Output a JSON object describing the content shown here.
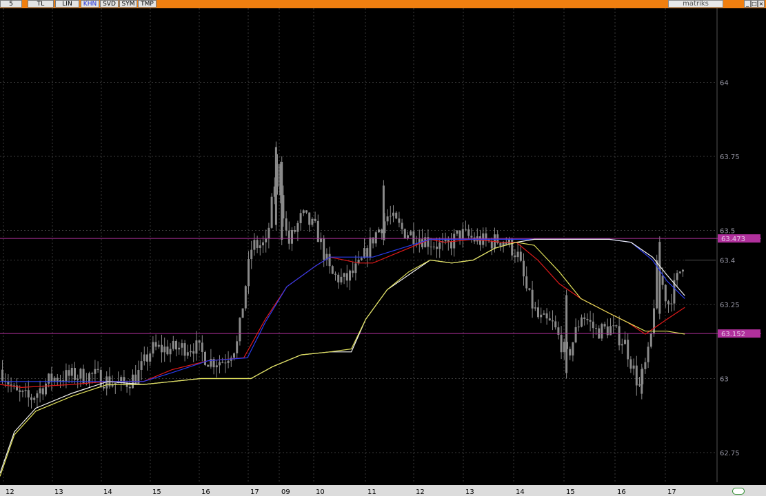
{
  "toolbar": {
    "buttons": [
      {
        "label": "5"
      },
      {
        "label": "TL"
      },
      {
        "label": "LIN"
      },
      {
        "label": "KHN",
        "active": true
      },
      {
        "label": "SVD"
      },
      {
        "label": "SYM"
      },
      {
        "label": "TMP"
      }
    ],
    "brand": "matriks",
    "window_buttons": [
      "_",
      "□",
      "×"
    ]
  },
  "colors": {
    "background": "#000000",
    "toolbar": "#f07f10",
    "grid": "#3a3a3a",
    "candle": "#8a8a8a",
    "level_line": "#b0309c",
    "series_red": "#e01a1a",
    "series_blue": "#2a3cf0",
    "series_white": "#f2f2f2",
    "series_yellow": "#e0e05a"
  },
  "chart_data": {
    "type": "line",
    "ylim": [
      62.65,
      64.25
    ],
    "y_ticks": [
      {
        "v": 64,
        "label": "64"
      },
      {
        "v": 63.75,
        "label": "63.75"
      },
      {
        "v": 63.5,
        "label": "63.5"
      },
      {
        "v": 63.4,
        "label": "63.4"
      },
      {
        "v": 63.25,
        "label": "63.25"
      },
      {
        "v": 63,
        "label": "63"
      },
      {
        "v": 62.75,
        "label": "62.75"
      }
    ],
    "x_ticks": [
      "12",
      "13",
      "14",
      "15",
      "16",
      "17",
      "09",
      "10",
      "11",
      "12",
      "13",
      "14",
      "15",
      "16",
      "17"
    ],
    "levels": [
      {
        "value": 63.473,
        "label": "63.473"
      },
      {
        "value": 63.152,
        "label": "63.152"
      }
    ],
    "price_marker": {
      "value": 63.4
    },
    "candle_anchors": [
      {
        "x": 0,
        "y": 63.03
      },
      {
        "x": 0.02,
        "y": 62.95
      },
      {
        "x": 0.04,
        "y": 62.93
      },
      {
        "x": 0.07,
        "y": 63.0
      },
      {
        "x": 0.1,
        "y": 63.01
      },
      {
        "x": 0.13,
        "y": 63.01
      },
      {
        "x": 0.15,
        "y": 62.99
      },
      {
        "x": 0.17,
        "y": 62.98
      },
      {
        "x": 0.19,
        "y": 63.01
      },
      {
        "x": 0.21,
        "y": 63.1
      },
      {
        "x": 0.24,
        "y": 63.1
      },
      {
        "x": 0.27,
        "y": 63.11
      },
      {
        "x": 0.29,
        "y": 63.06
      },
      {
        "x": 0.31,
        "y": 63.06
      },
      {
        "x": 0.33,
        "y": 63.12
      },
      {
        "x": 0.34,
        "y": 63.3
      },
      {
        "x": 0.35,
        "y": 63.45
      },
      {
        "x": 0.37,
        "y": 63.45
      },
      {
        "x": 0.385,
        "y": 63.72
      },
      {
        "x": 0.4,
        "y": 63.45
      },
      {
        "x": 0.42,
        "y": 63.55
      },
      {
        "x": 0.44,
        "y": 63.5
      },
      {
        "x": 0.46,
        "y": 63.35
      },
      {
        "x": 0.48,
        "y": 63.33
      },
      {
        "x": 0.5,
        "y": 63.38
      },
      {
        "x": 0.52,
        "y": 63.48
      },
      {
        "x": 0.54,
        "y": 63.55
      },
      {
        "x": 0.56,
        "y": 63.5
      },
      {
        "x": 0.58,
        "y": 63.48
      },
      {
        "x": 0.6,
        "y": 63.46
      },
      {
        "x": 0.62,
        "y": 63.44
      },
      {
        "x": 0.64,
        "y": 63.49
      },
      {
        "x": 0.66,
        "y": 63.47
      },
      {
        "x": 0.68,
        "y": 63.46
      },
      {
        "x": 0.7,
        "y": 63.47
      },
      {
        "x": 0.72,
        "y": 63.42
      },
      {
        "x": 0.735,
        "y": 63.28
      },
      {
        "x": 0.75,
        "y": 63.2
      },
      {
        "x": 0.77,
        "y": 63.18
      },
      {
        "x": 0.79,
        "y": 63.07
      },
      {
        "x": 0.81,
        "y": 63.22
      },
      {
        "x": 0.83,
        "y": 63.16
      },
      {
        "x": 0.85,
        "y": 63.17
      },
      {
        "x": 0.87,
        "y": 63.12
      },
      {
        "x": 0.89,
        "y": 62.97
      },
      {
        "x": 0.905,
        "y": 63.1
      },
      {
        "x": 0.915,
        "y": 63.38
      },
      {
        "x": 0.93,
        "y": 63.25
      },
      {
        "x": 0.945,
        "y": 63.35
      },
      {
        "x": 0.955,
        "y": 63.42
      }
    ],
    "spikes": [
      {
        "x": 0.385,
        "hi": 63.8,
        "lo": 63.5
      },
      {
        "x": 0.393,
        "hi": 63.75,
        "lo": 63.45
      },
      {
        "x": 0.535,
        "hi": 63.67,
        "lo": 63.45
      },
      {
        "x": 0.79,
        "hi": 63.3,
        "lo": 63.0
      },
      {
        "x": 0.895,
        "hi": 63.05,
        "lo": 62.93
      },
      {
        "x": 0.92,
        "hi": 63.48,
        "lo": 63.2
      }
    ],
    "series": [
      {
        "color": "red",
        "points": [
          {
            "x": 0,
            "y": 62.98
          },
          {
            "x": 0.03,
            "y": 62.97
          },
          {
            "x": 0.1,
            "y": 62.98
          },
          {
            "x": 0.15,
            "y": 62.99
          },
          {
            "x": 0.2,
            "y": 62.99
          },
          {
            "x": 0.24,
            "y": 63.03
          },
          {
            "x": 0.29,
            "y": 63.06
          },
          {
            "x": 0.34,
            "y": 63.07
          },
          {
            "x": 0.37,
            "y": 63.2
          },
          {
            "x": 0.4,
            "y": 63.31
          },
          {
            "x": 0.44,
            "y": 63.38
          },
          {
            "x": 0.46,
            "y": 63.41
          },
          {
            "x": 0.5,
            "y": 63.39
          },
          {
            "x": 0.52,
            "y": 63.39
          },
          {
            "x": 0.56,
            "y": 63.43
          },
          {
            "x": 0.6,
            "y": 63.47
          },
          {
            "x": 0.62,
            "y": 63.46
          },
          {
            "x": 0.66,
            "y": 63.47
          },
          {
            "x": 0.7,
            "y": 63.46
          },
          {
            "x": 0.72,
            "y": 63.46
          },
          {
            "x": 0.75,
            "y": 63.4
          },
          {
            "x": 0.78,
            "y": 63.32
          },
          {
            "x": 0.81,
            "y": 63.27
          },
          {
            "x": 0.85,
            "y": 63.22
          },
          {
            "x": 0.875,
            "y": 63.19
          },
          {
            "x": 0.9,
            "y": 63.15
          },
          {
            "x": 0.93,
            "y": 63.2
          },
          {
            "x": 0.955,
            "y": 63.24
          }
        ]
      },
      {
        "color": "blue",
        "points": [
          {
            "x": 0,
            "y": 62.99
          },
          {
            "x": 0.03,
            "y": 62.99
          },
          {
            "x": 0.1,
            "y": 62.99
          },
          {
            "x": 0.15,
            "y": 62.99
          },
          {
            "x": 0.2,
            "y": 62.99
          },
          {
            "x": 0.24,
            "y": 63.02
          },
          {
            "x": 0.29,
            "y": 63.06
          },
          {
            "x": 0.345,
            "y": 63.07
          },
          {
            "x": 0.37,
            "y": 63.19
          },
          {
            "x": 0.4,
            "y": 63.31
          },
          {
            "x": 0.44,
            "y": 63.38
          },
          {
            "x": 0.46,
            "y": 63.41
          },
          {
            "x": 0.5,
            "y": 63.41
          },
          {
            "x": 0.52,
            "y": 63.41
          },
          {
            "x": 0.56,
            "y": 63.44
          },
          {
            "x": 0.6,
            "y": 63.47
          },
          {
            "x": 0.66,
            "y": 63.47
          },
          {
            "x": 0.72,
            "y": 63.47
          },
          {
            "x": 0.78,
            "y": 63.47
          },
          {
            "x": 0.85,
            "y": 63.47
          },
          {
            "x": 0.88,
            "y": 63.46
          },
          {
            "x": 0.91,
            "y": 63.4
          },
          {
            "x": 0.93,
            "y": 63.33
          },
          {
            "x": 0.955,
            "y": 63.27
          }
        ]
      },
      {
        "color": "white",
        "points": [
          {
            "x": 0,
            "y": 62.68
          },
          {
            "x": 0.02,
            "y": 62.82
          },
          {
            "x": 0.05,
            "y": 62.9
          },
          {
            "x": 0.1,
            "y": 62.95
          },
          {
            "x": 0.15,
            "y": 62.99
          },
          {
            "x": 0.2,
            "y": 62.98
          },
          {
            "x": 0.24,
            "y": 62.99
          },
          {
            "x": 0.28,
            "y": 63.0
          },
          {
            "x": 0.33,
            "y": 63.0
          },
          {
            "x": 0.35,
            "y": 63.0
          },
          {
            "x": 0.38,
            "y": 63.04
          },
          {
            "x": 0.42,
            "y": 63.08
          },
          {
            "x": 0.46,
            "y": 63.09
          },
          {
            "x": 0.49,
            "y": 63.09
          },
          {
            "x": 0.51,
            "y": 63.2
          },
          {
            "x": 0.54,
            "y": 63.3
          },
          {
            "x": 0.57,
            "y": 63.35
          },
          {
            "x": 0.6,
            "y": 63.4
          },
          {
            "x": 0.63,
            "y": 63.39
          },
          {
            "x": 0.66,
            "y": 63.4
          },
          {
            "x": 0.69,
            "y": 63.44
          },
          {
            "x": 0.72,
            "y": 63.46
          },
          {
            "x": 0.745,
            "y": 63.47
          },
          {
            "x": 0.78,
            "y": 63.47
          },
          {
            "x": 0.85,
            "y": 63.47
          },
          {
            "x": 0.88,
            "y": 63.46
          },
          {
            "x": 0.91,
            "y": 63.41
          },
          {
            "x": 0.93,
            "y": 63.35
          },
          {
            "x": 0.955,
            "y": 63.28
          }
        ]
      },
      {
        "color": "yellow",
        "points": [
          {
            "x": 0,
            "y": 62.67
          },
          {
            "x": 0.02,
            "y": 62.81
          },
          {
            "x": 0.05,
            "y": 62.89
          },
          {
            "x": 0.1,
            "y": 62.94
          },
          {
            "x": 0.15,
            "y": 62.98
          },
          {
            "x": 0.2,
            "y": 62.98
          },
          {
            "x": 0.24,
            "y": 62.99
          },
          {
            "x": 0.28,
            "y": 63.0
          },
          {
            "x": 0.35,
            "y": 63.0
          },
          {
            "x": 0.38,
            "y": 63.04
          },
          {
            "x": 0.42,
            "y": 63.08
          },
          {
            "x": 0.46,
            "y": 63.09
          },
          {
            "x": 0.49,
            "y": 63.1
          },
          {
            "x": 0.51,
            "y": 63.2
          },
          {
            "x": 0.54,
            "y": 63.3
          },
          {
            "x": 0.57,
            "y": 63.36
          },
          {
            "x": 0.6,
            "y": 63.4
          },
          {
            "x": 0.63,
            "y": 63.39
          },
          {
            "x": 0.66,
            "y": 63.4
          },
          {
            "x": 0.69,
            "y": 63.44
          },
          {
            "x": 0.72,
            "y": 63.46
          },
          {
            "x": 0.745,
            "y": 63.45
          },
          {
            "x": 0.78,
            "y": 63.36
          },
          {
            "x": 0.81,
            "y": 63.27
          },
          {
            "x": 0.85,
            "y": 63.22
          },
          {
            "x": 0.875,
            "y": 63.19
          },
          {
            "x": 0.9,
            "y": 63.16
          },
          {
            "x": 0.915,
            "y": 63.16
          },
          {
            "x": 0.93,
            "y": 63.16
          },
          {
            "x": 0.955,
            "y": 63.15
          }
        ]
      }
    ]
  }
}
